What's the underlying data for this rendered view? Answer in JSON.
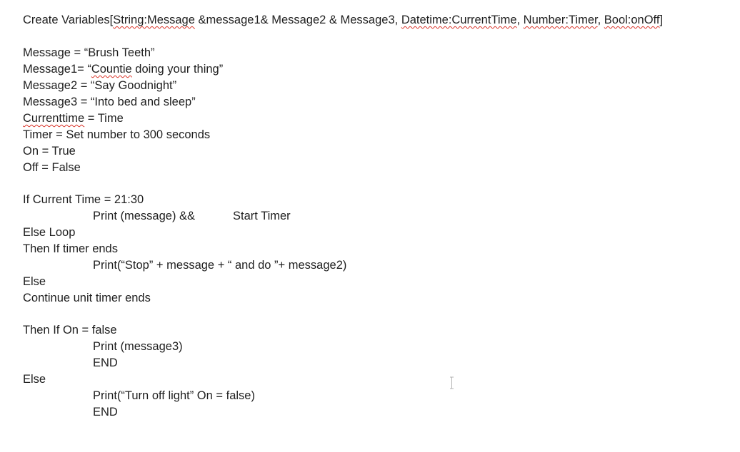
{
  "document": {
    "header_line": {
      "prefix": "Create Variables[",
      "spell1": "String:Message",
      "mid1": " &message1& Message2 & Message3, ",
      "spell2": "Datetime:CurrentTime",
      "mid2": ", ",
      "spell3": "Number:Timer",
      "mid3": ", ",
      "spell4": "Bool:onOff",
      "suffix": "]"
    },
    "message_line": "Message = “Brush Teeth”",
    "message1_line": {
      "prefix": "Message1= “",
      "spell": "Countie",
      "suffix": " doing your thing”"
    },
    "message2_line": "Message2 = “Say Goodnight”",
    "message3_line": "Message3 = “Into bed and sleep”",
    "currenttime_line": {
      "spell": "Currenttime",
      "suffix": " = Time"
    },
    "timer_line": "Timer = Set number to 300 seconds",
    "on_line": "On = True",
    "off_line": "Off = False",
    "if_current_time": "If Current Time = 21:30",
    "print_message": "Print (message) &&",
    "start_timer": "Start Timer",
    "else_loop": "Else Loop",
    "then_if_timer": "Then If timer ends",
    "print_stop": "Print(“Stop” + message + “ and do ”+ message2)",
    "else1": "Else",
    "continue_until": "Continue unit timer ends",
    "then_if_on": "Then If On = false",
    "print_message3": "Print (message3)",
    "end1": "END",
    "else2": "Else",
    "print_turn_off": "Print(“Turn off light” On = false)",
    "end2": "END"
  },
  "colors": {
    "text": "#1f1f1f",
    "spellcheck_underline": "#d93025",
    "background": "#ffffff"
  },
  "icons": {
    "cursor": "i-beam-cursor-icon"
  }
}
